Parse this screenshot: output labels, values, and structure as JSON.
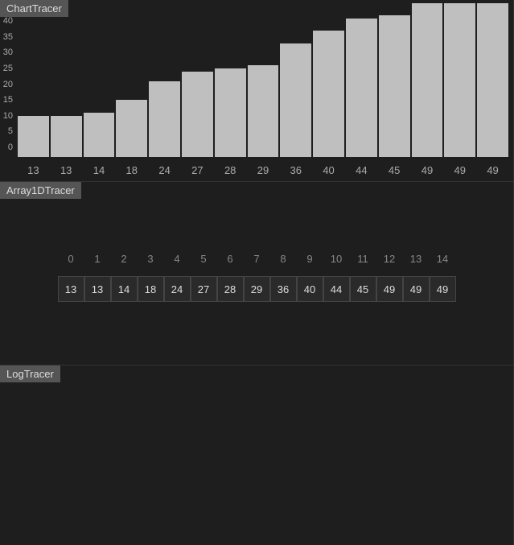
{
  "labels": {
    "chart_tracer": "ChartTracer",
    "array_tracer": "Array1DTracer",
    "log_tracer": "LogTracer"
  },
  "chart_data": {
    "type": "bar",
    "categories": [
      "13",
      "13",
      "14",
      "18",
      "24",
      "27",
      "28",
      "29",
      "36",
      "40",
      "44",
      "45",
      "49",
      "49",
      "49"
    ],
    "values": [
      13,
      13,
      14,
      18,
      24,
      27,
      28,
      29,
      36,
      40,
      44,
      45,
      49,
      49,
      49
    ],
    "ylim": [
      0,
      49
    ],
    "y_ticks": [
      0,
      5,
      10,
      15,
      20,
      25,
      30,
      35,
      40
    ],
    "title": "",
    "xlabel": "",
    "ylabel": ""
  },
  "array": {
    "indices": [
      "0",
      "1",
      "2",
      "3",
      "4",
      "5",
      "6",
      "7",
      "8",
      "9",
      "10",
      "11",
      "12",
      "13",
      "14"
    ],
    "values": [
      "13",
      "13",
      "14",
      "18",
      "24",
      "27",
      "28",
      "29",
      "36",
      "40",
      "44",
      "45",
      "49",
      "49",
      "49"
    ]
  }
}
